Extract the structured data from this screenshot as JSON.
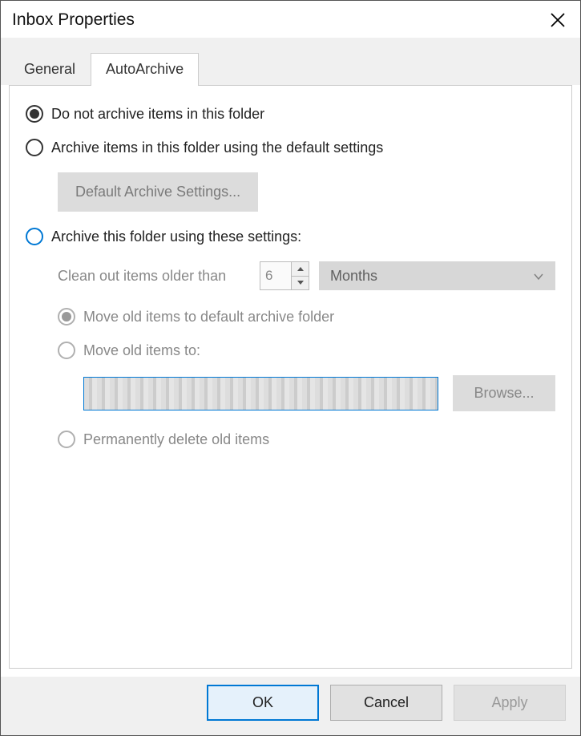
{
  "window": {
    "title": "Inbox Properties"
  },
  "tabs": {
    "general": "General",
    "autoarchive": "AutoArchive"
  },
  "options": {
    "do_not_archive": "Do not archive items in this folder",
    "default_settings": "Archive items in this folder using the default settings",
    "default_button": "Default Archive Settings...",
    "custom_settings": "Archive this folder using these settings:",
    "clean_label": "Clean out items older than",
    "clean_value": "6",
    "clean_unit": "Months",
    "move_default": "Move old items to default archive folder",
    "move_to": "Move old items to:",
    "browse": "Browse...",
    "permanently_delete": "Permanently delete old items"
  },
  "footer": {
    "ok": "OK",
    "cancel": "Cancel",
    "apply": "Apply"
  }
}
